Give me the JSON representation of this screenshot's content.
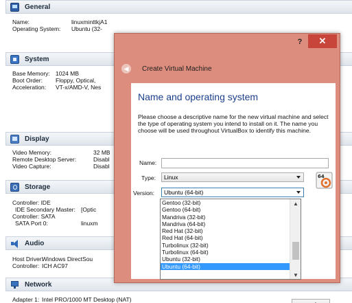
{
  "sections": {
    "general": {
      "title": "General",
      "rows": [
        {
          "key": "Name:",
          "value": "linuxminttkjA1"
        },
        {
          "key": "Operating System:",
          "value": "Ubuntu (32-"
        }
      ]
    },
    "system": {
      "title": "System",
      "rows": [
        {
          "key": "Base Memory:",
          "value": "1024 MB"
        },
        {
          "key": "Boot Order:",
          "value": "Floppy, Optical,"
        },
        {
          "key": "Acceleration:",
          "value": "VT-x/AMD-V, Nes"
        }
      ]
    },
    "display": {
      "title": "Display",
      "rows": [
        {
          "key": "Video Memory:",
          "value": "32 MB"
        },
        {
          "key": "Remote Desktop Server:",
          "value": "Disabl"
        },
        {
          "key": "Video Capture:",
          "value": "Disabl"
        }
      ]
    },
    "storage": {
      "title": "Storage",
      "rows": [
        {
          "key": "Controller: IDE",
          "value": ""
        },
        {
          "key": "IDE Secondary Master:",
          "value": "[Optic"
        },
        {
          "key": "Controller: SATA",
          "value": ""
        },
        {
          "key": "SATA Port 0:",
          "value": "linuxm"
        }
      ]
    },
    "audio": {
      "title": "Audio",
      "rows": [
        {
          "key": "Host Driver:",
          "value": "Windows DirectSou"
        },
        {
          "key": "Controller:",
          "value": "ICH AC97"
        }
      ]
    },
    "network": {
      "title": "Network",
      "rows": [
        {
          "key": "Adapter 1:",
          "value": "Intel PRO/1000 MT Desktop (NAT)"
        }
      ]
    }
  },
  "dialog": {
    "help": "?",
    "close": "✕",
    "title": "Create Virtual Machine",
    "page_title": "Name and operating system",
    "description": "Please choose a descriptive name for the new virtual machine and select the type of operating system you intend to install on it. The name you choose will be used throughout VirtualBox to identify this machine.",
    "name_label": "Name:",
    "name_value": "",
    "type_label": "Type:",
    "type_value": "Linux",
    "version_label": "Version:",
    "version_value": "Ubuntu (64-bit)",
    "os_icon_text": "64",
    "cancel_label": "ncel",
    "version_options": [
      "Gentoo (32-bit)",
      "Gentoo (64-bit)",
      "Mandriva (32-bit)",
      "Mandriva (64-bit)",
      "Red Hat (32-bit)",
      "Red Hat (64-bit)",
      "Turbolinux (32-bit)",
      "Turbolinux (64-bit)",
      "Ubuntu (32-bit)",
      "Ubuntu (64-bit)"
    ],
    "selected_index": 9
  },
  "colors": {
    "dialog_frame": "#dd8d7e",
    "close_button": "#c7453a",
    "page_title": "#1b3f8c",
    "selection": "#3399ff"
  }
}
